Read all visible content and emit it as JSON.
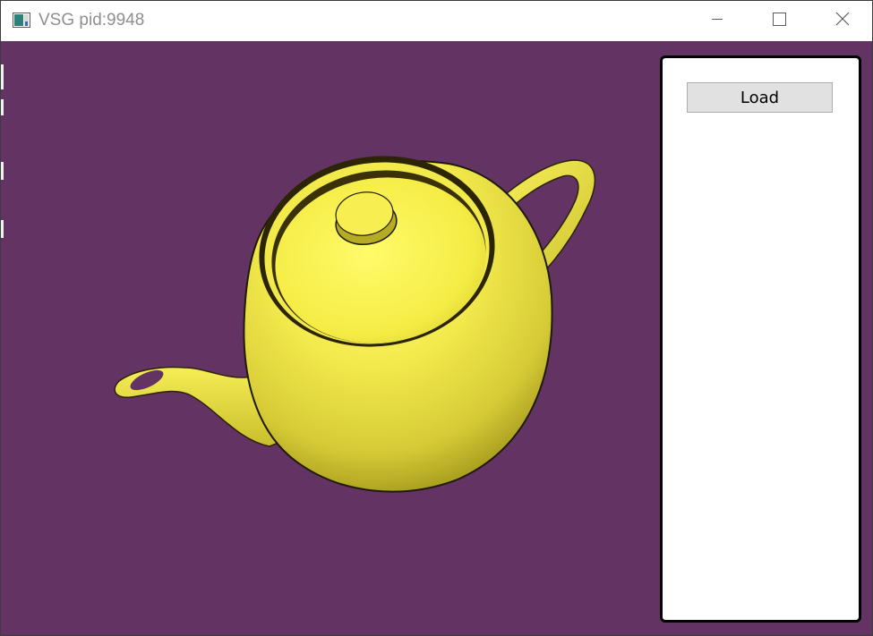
{
  "window": {
    "title": "VSG pid:9948",
    "icon": "app-window-icon",
    "controls": {
      "minimize_icon": "minimize-icon",
      "maximize_icon": "maximize-icon",
      "close_icon": "close-icon"
    }
  },
  "scene": {
    "background_color": "#633363",
    "object": "teapot",
    "object_color": "#f2ea4a"
  },
  "panel": {
    "load_label": "Load"
  }
}
